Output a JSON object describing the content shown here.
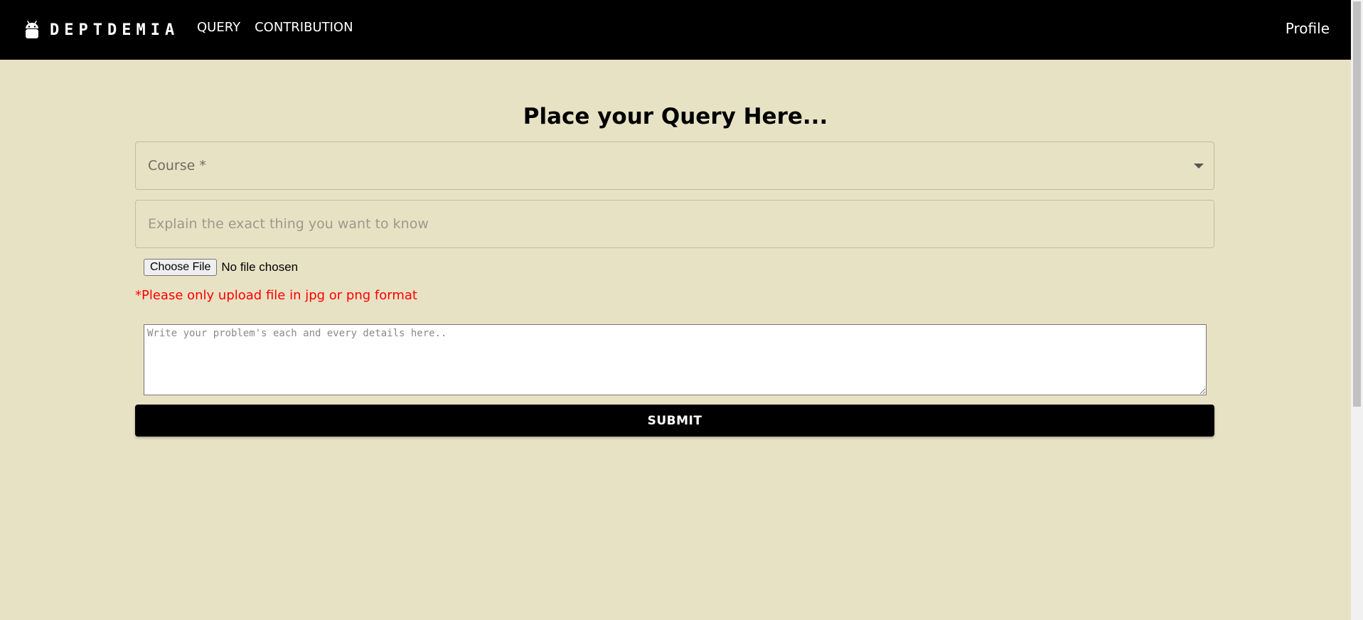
{
  "header": {
    "brand": "DEPTDEMIA",
    "nav": [
      "QUERY",
      "CONTRIBUTION"
    ],
    "profile_label": "Profile"
  },
  "form": {
    "title": "Place your Query Here...",
    "course_label": "Course *",
    "explain_placeholder": "Explain the exact thing you want to know",
    "file_button_label": "Choose File",
    "file_status": "No file chosen",
    "upload_note": "*Please only upload file in jpg or png format",
    "details_placeholder": "Write your problem's each and every details here..",
    "submit_label": "SUBMIT"
  },
  "icons": {
    "brand": "android-icon",
    "course_dropdown": "chevron-down-icon"
  },
  "colors": {
    "page_background": "#e8e2c5",
    "header_background": "#000000",
    "note_color": "#ff0000",
    "submit_background": "#000000"
  }
}
